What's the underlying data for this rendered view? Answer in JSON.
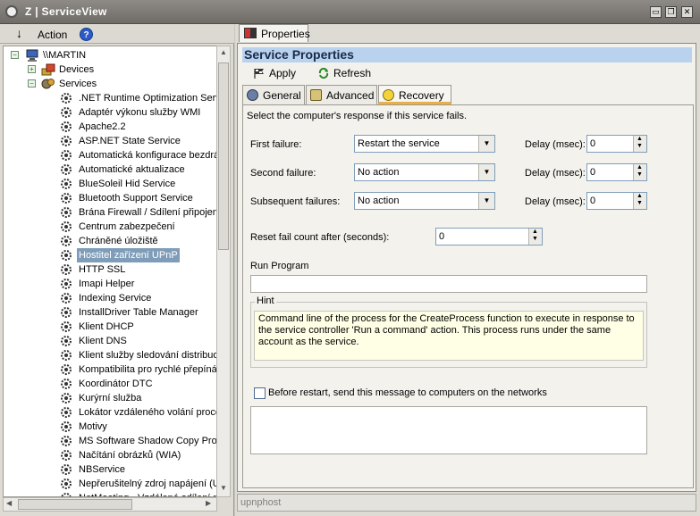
{
  "window": {
    "title": "Z | ServiceView",
    "minimize": "▭",
    "restore": "❐",
    "close": "✕"
  },
  "left_toolbar": {
    "action_label": "Action",
    "down_arrow": "↓",
    "help_icon": "?"
  },
  "tree": {
    "computer": "\\\\MARTIN",
    "devices": "Devices",
    "services": "Services",
    "service_items": [
      ".NET Runtime Optimization Servi",
      "Adaptér výkonu služby WMI",
      "Apache2.2",
      "ASP.NET State Service",
      "Automatická konfigurace bezdrát",
      "Automatické aktualizace",
      "BlueSoleil Hid Service",
      "Bluetooth Support Service",
      "Brána Firewall / Sdílení připojení",
      "Centrum zabezpečení",
      "Chráněné úložiště",
      "Hostitel zařízení UPnP",
      "HTTP SSL",
      "Imapi Helper",
      "Indexing Service",
      "InstallDriver Table Manager",
      "Klient DHCP",
      "Klient DNS",
      "Klient služby sledování distribuov",
      "Kompatibilita pro rychlé přepínán",
      "Koordinátor DTC",
      "Kurýrní služba",
      "Lokátor vzdáleného volání proce",
      "Motivy",
      "MS Software Shadow Copy Prov",
      "Načítání obrázků (WIA)",
      "NBService",
      "Nepřerušitelný zdroj napájení (UF",
      "NetMeeting - Vzdálené sdílení pl"
    ],
    "selected_index": 11
  },
  "right": {
    "properties_tab": "Properties",
    "header": "Service Properties",
    "toolbar": {
      "apply": "Apply",
      "refresh": "Refresh"
    },
    "tabs": {
      "general": "General",
      "advanced": "Advanced",
      "recovery": "Recovery"
    },
    "recovery": {
      "intro": "Select the computer's response if this service fails.",
      "first_failure_label": "First failure:",
      "first_failure_value": "Restart the service",
      "second_failure_label": "Second failure:",
      "second_failure_value": "No action",
      "subsequent_failures_label": "Subsequent failures:",
      "subsequent_failures_value": "No action",
      "delay_label": "Delay (msec):",
      "delay_first": "0",
      "delay_second": "0",
      "delay_subsequent": "0",
      "reset_label": "Reset fail count after (seconds):",
      "reset_value": "0",
      "run_program_label": "Run Program",
      "run_program_value": "",
      "hint_caption": "Hint",
      "hint_text": "Command line of the process for the CreateProcess function to execute in response to the service controller 'Run a command' action. This process runs under the same account as the service.",
      "before_restart_label": "Before restart, send this message to computers on the networks",
      "message_value": ""
    },
    "status": "upnphost"
  },
  "colors": {
    "selection": "#7f9db9",
    "header_bg": "#b9d2ee",
    "hint_bg": "#ffffe5",
    "active_tab_accent": "#e8b04a"
  }
}
